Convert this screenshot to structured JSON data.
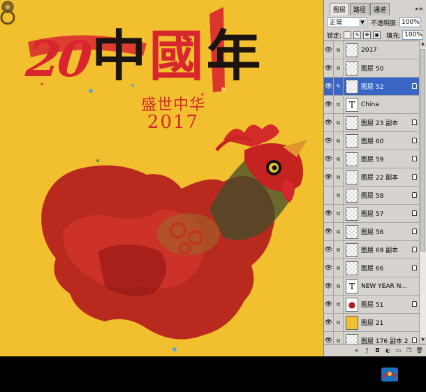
{
  "artwork": {
    "headline_20": "20",
    "headline_chars": [
      "中",
      "國",
      "年"
    ],
    "stamp_line1": "盛世中华",
    "stamp_line2": "2017"
  },
  "layers_panel": {
    "tabs": [
      "图层",
      "路径",
      "通道"
    ],
    "blend_mode": "正常",
    "opacity_label": "不透明度:",
    "opacity_value": "100%",
    "lock_label": "锁定:",
    "fill_label": "填充:",
    "fill_value": "100%",
    "layers": [
      {
        "name": "2017",
        "kind": "pixel",
        "visible": true,
        "locked": false,
        "selected": false
      },
      {
        "name": "图层 50",
        "kind": "pixel",
        "visible": true,
        "locked": false,
        "selected": false
      },
      {
        "name": "图层 52",
        "kind": "pixel",
        "visible": true,
        "locked": true,
        "selected": true
      },
      {
        "name": "China",
        "kind": "text",
        "visible": true,
        "locked": false,
        "selected": false
      },
      {
        "name": "图层 23 副本",
        "kind": "pixel",
        "visible": true,
        "locked": true,
        "selected": false
      },
      {
        "name": "图层 60",
        "kind": "pixel",
        "visible": true,
        "locked": true,
        "selected": false
      },
      {
        "name": "图层 59",
        "kind": "pixel",
        "visible": true,
        "locked": true,
        "selected": false
      },
      {
        "name": "图层 22 副本",
        "kind": "pixel",
        "visible": true,
        "locked": true,
        "selected": false
      },
      {
        "name": "图层 58",
        "kind": "pixel",
        "visible": false,
        "locked": true,
        "selected": false
      },
      {
        "name": "图层 57",
        "kind": "pixel",
        "visible": true,
        "locked": true,
        "selected": false
      },
      {
        "name": "图层 56",
        "kind": "pixel",
        "visible": true,
        "locked": true,
        "selected": false
      },
      {
        "name": "图层 69 副本",
        "kind": "pixel",
        "visible": true,
        "locked": true,
        "selected": false
      },
      {
        "name": "图层 66",
        "kind": "pixel",
        "visible": true,
        "locked": true,
        "selected": false
      },
      {
        "name": "NEW YEAR N...",
        "kind": "text",
        "visible": true,
        "locked": false,
        "selected": false
      },
      {
        "name": "图层 51",
        "kind": "hen",
        "visible": true,
        "locked": true,
        "selected": false
      },
      {
        "name": "图层 21",
        "kind": "gold",
        "visible": true,
        "locked": false,
        "selected": false
      },
      {
        "name": "图层 176 副本 2",
        "kind": "pixel",
        "visible": true,
        "locked": true,
        "selected": false
      }
    ]
  },
  "colors": {
    "canvas_bg": "#f2bf2f",
    "red": "#d7262d",
    "selection": "#3a67c6"
  }
}
